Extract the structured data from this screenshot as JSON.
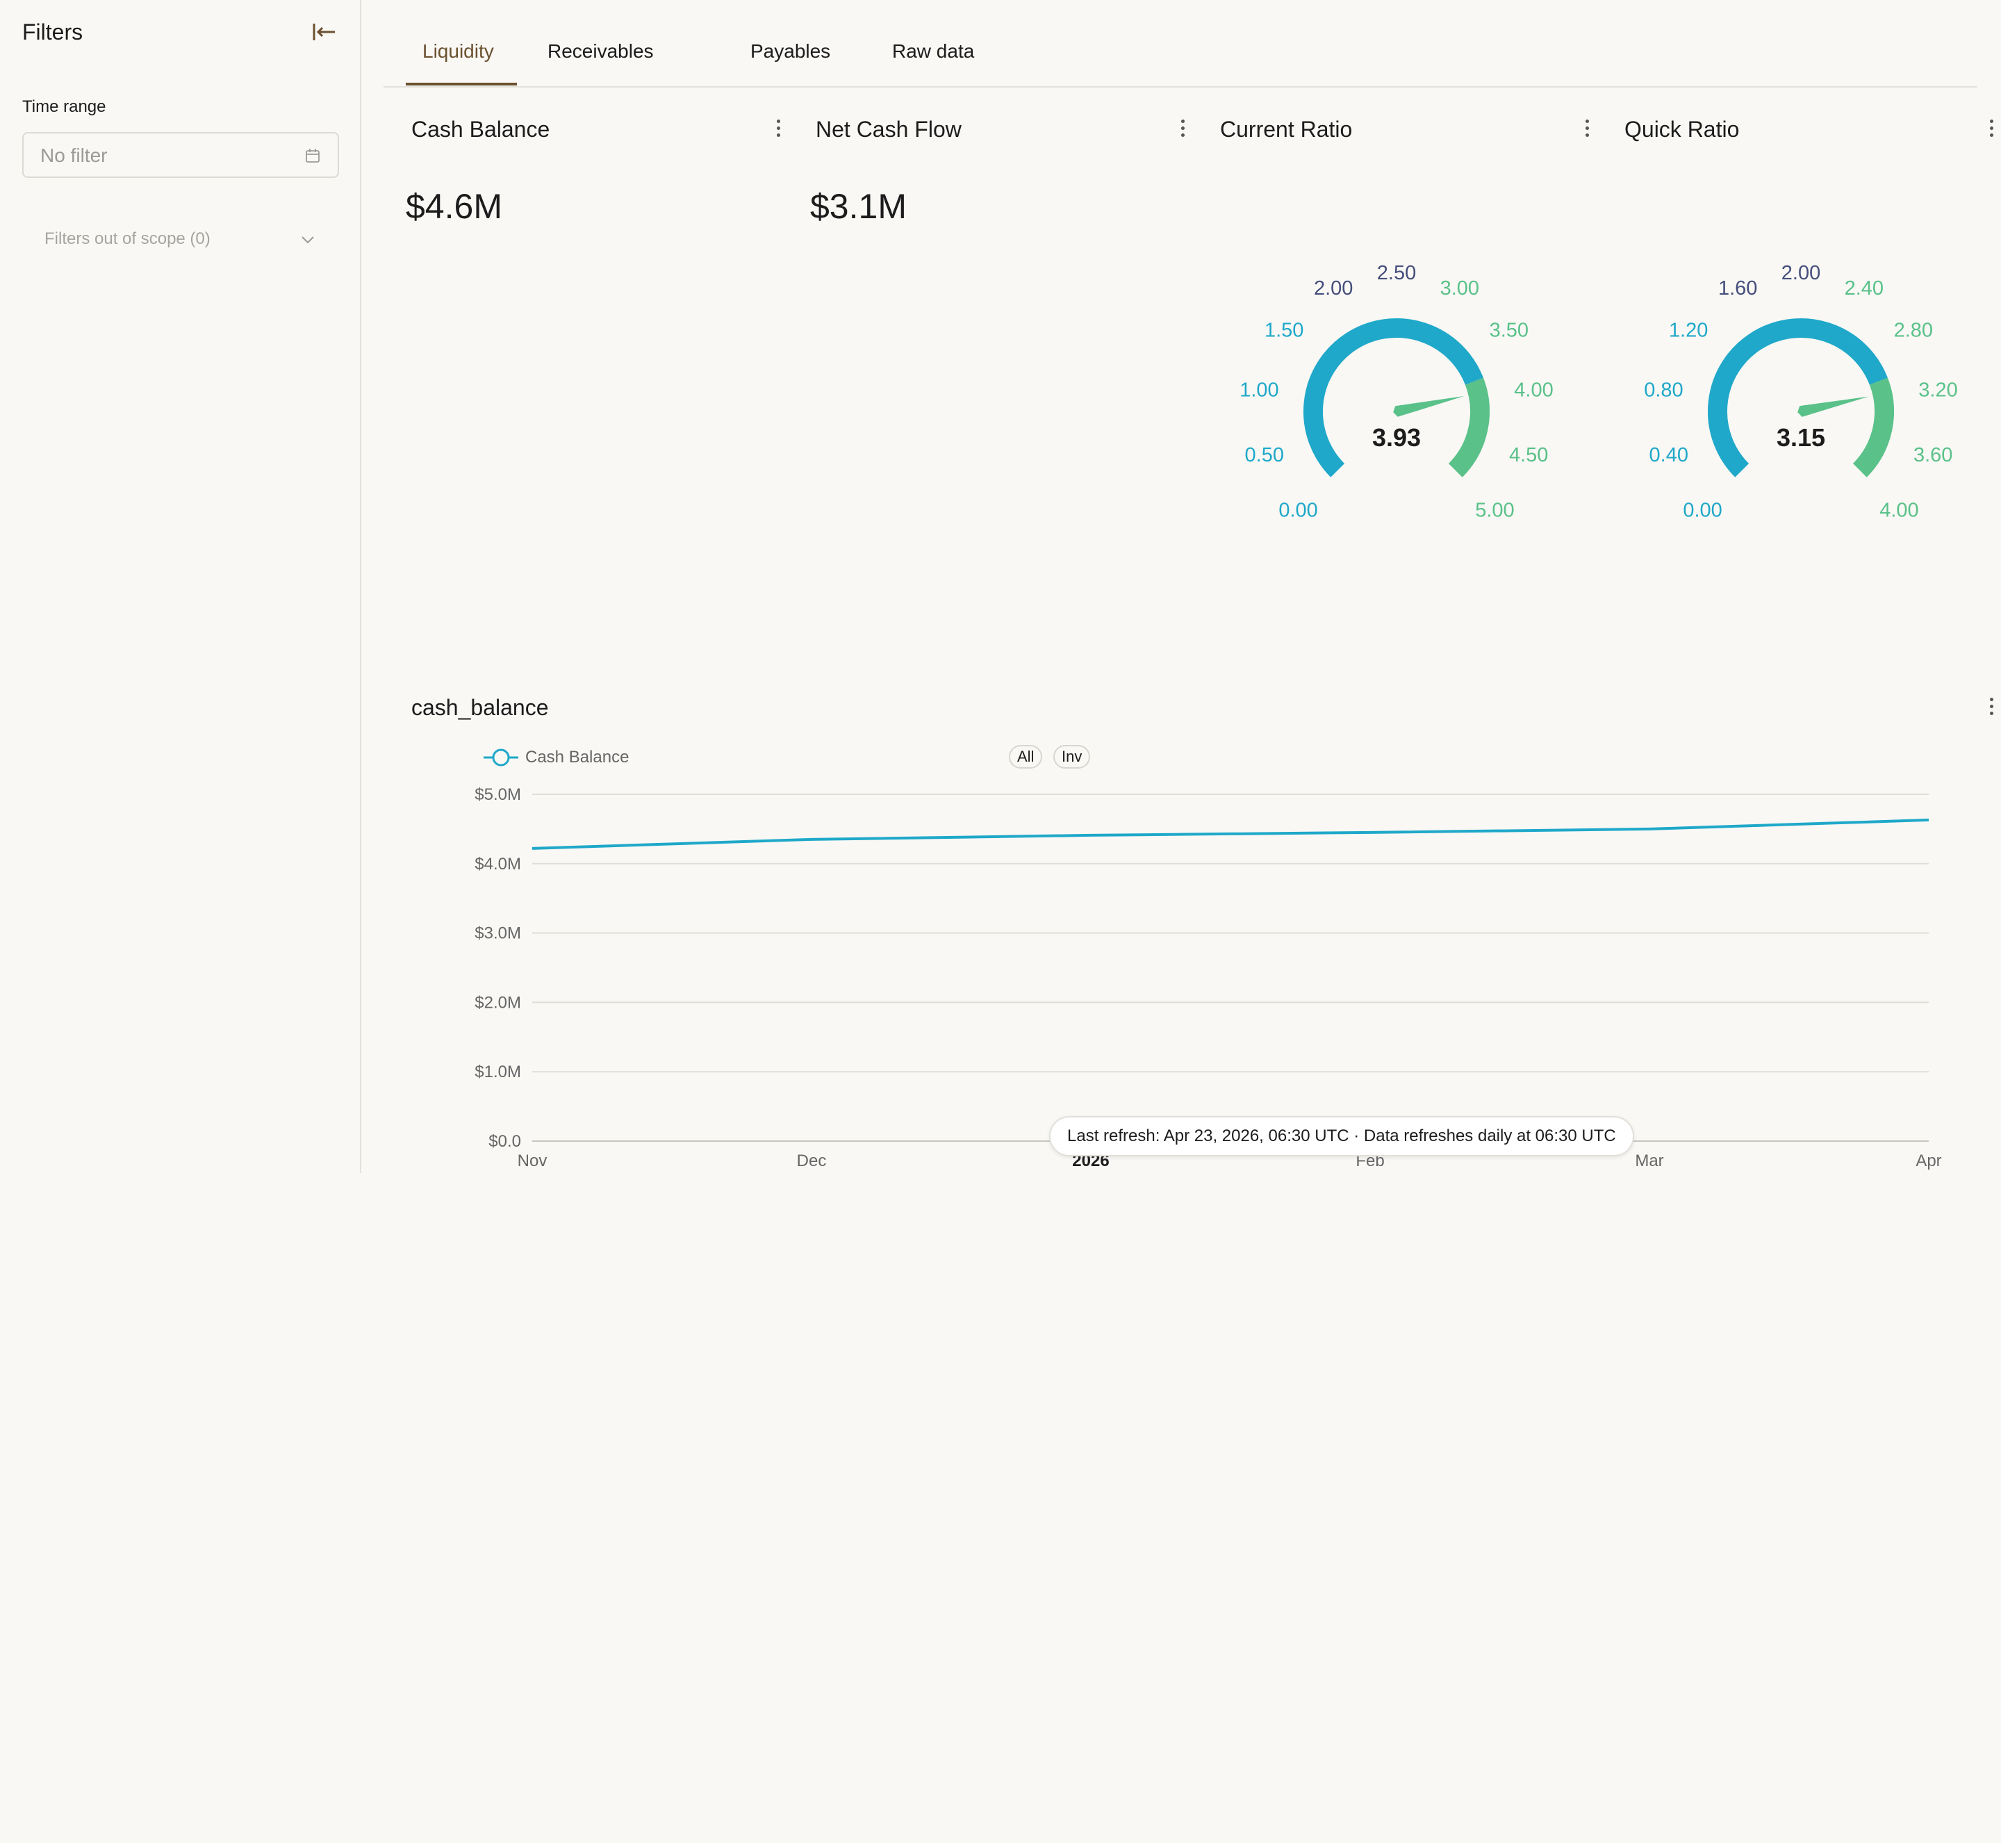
{
  "sidebar": {
    "title": "Filters",
    "time_range_label": "Time range",
    "time_range_placeholder": "No filter",
    "out_of_scope": "Filters out of scope (0)"
  },
  "tabs": [
    {
      "label": "Liquidity",
      "active": true
    },
    {
      "label": "Receivables",
      "active": false
    },
    {
      "label": "Payables",
      "active": false
    },
    {
      "label": "Raw data",
      "active": false
    }
  ],
  "cards": {
    "cash_balance": {
      "title": "Cash Balance",
      "value": "$4.6M"
    },
    "net_cash_flow": {
      "title": "Net Cash Flow",
      "value": "$3.1M"
    },
    "current_ratio": {
      "title": "Current Ratio",
      "value": 3.93,
      "value_label": "3.93",
      "max": 5,
      "ticks": [
        "0.00",
        "0.50",
        "1.00",
        "1.50",
        "2.00",
        "2.50",
        "3.00",
        "3.50",
        "4.00",
        "4.50",
        "5.00"
      ]
    },
    "quick_ratio": {
      "title": "Quick Ratio",
      "value": 3.15,
      "value_label": "3.15",
      "max": 4,
      "ticks": [
        "0.00",
        "0.40",
        "0.80",
        "1.20",
        "1.60",
        "2.00",
        "2.40",
        "2.80",
        "3.20",
        "3.60",
        "4.00"
      ]
    }
  },
  "colors": {
    "accent": "#6b5130",
    "gauge_blue": "#1fa8c9",
    "gauge_green": "#5ac189",
    "gauge_navy": "#454e7c",
    "line": "#1fa8c9"
  },
  "chart_section": {
    "title": "cash_balance",
    "legend_label": "Cash Balance",
    "buttons": [
      "All",
      "Inv"
    ]
  },
  "chart_data": {
    "type": "line",
    "x": [
      "Nov",
      "Dec",
      "Jan",
      "Feb",
      "Mar",
      "Apr"
    ],
    "x_tick_labels": [
      "Nov",
      "Dec",
      "2026",
      "Feb",
      "Mar",
      "Apr"
    ],
    "series": [
      {
        "name": "Cash Balance",
        "values": [
          4.22,
          4.35,
          4.41,
          4.45,
          4.5,
          4.63
        ]
      }
    ],
    "y_ticks": [
      "$0.0",
      "$1.0M",
      "$2.0M",
      "$3.0M",
      "$4.0M",
      "$5.0M"
    ],
    "ylim": [
      0,
      5
    ],
    "grid": true,
    "legend": "top-left"
  },
  "footer": {
    "refresh_text": "Last refresh: Apr 23, 2026, 06:30 UTC · Data refreshes daily at 06:30 UTC"
  }
}
